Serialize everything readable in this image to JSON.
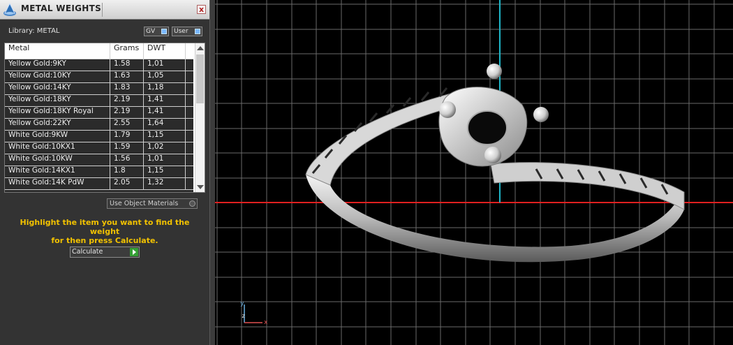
{
  "window": {
    "title": "METAL WEIGHTS",
    "close_label": "x",
    "icon": "app-logo-icon"
  },
  "library": {
    "label": "Library: METAL",
    "toggles": [
      {
        "label": "GV",
        "icon": "toggle-switch-icon"
      },
      {
        "label": "User",
        "icon": "toggle-switch-icon"
      }
    ]
  },
  "table": {
    "columns": [
      "Metal",
      "Grams",
      "DWT"
    ],
    "rows": [
      {
        "metal": "Yellow Gold:9KY",
        "grams": "1.58",
        "dwt": "1,01"
      },
      {
        "metal": "Yellow Gold:10KY",
        "grams": "1.63",
        "dwt": "1,05"
      },
      {
        "metal": "Yellow Gold:14KY",
        "grams": "1.83",
        "dwt": "1,18"
      },
      {
        "metal": "Yellow Gold:18KY",
        "grams": "2.19",
        "dwt": "1,41"
      },
      {
        "metal": "Yellow Gold:18KY Royal",
        "grams": "2.19",
        "dwt": "1,41"
      },
      {
        "metal": "Yellow Gold:22KY",
        "grams": "2.55",
        "dwt": "1,64"
      },
      {
        "metal": "White Gold:9KW",
        "grams": "1.79",
        "dwt": "1,15"
      },
      {
        "metal": "White Gold:10KX1",
        "grams": "1.59",
        "dwt": "1,02"
      },
      {
        "metal": "White Gold:10KW",
        "grams": "1.56",
        "dwt": "1,01"
      },
      {
        "metal": "White Gold:14KX1",
        "grams": "1.8",
        "dwt": "1,15"
      },
      {
        "metal": "White Gold:14K PdW",
        "grams": "2.05",
        "dwt": "1,32"
      }
    ]
  },
  "use_object_materials": "Use Object Materials",
  "hint": {
    "line1": "Highlight the item you want to find the weight",
    "line2": "for then press Calculate."
  },
  "calculate_label": "Calculate",
  "viewport": {
    "gizmo": {
      "y": "y",
      "z": "z",
      "x": "x"
    },
    "colors": {
      "x_axis": "#e02020",
      "y_axis": "#1fb6c8",
      "grid": "#6a6a6a"
    }
  }
}
